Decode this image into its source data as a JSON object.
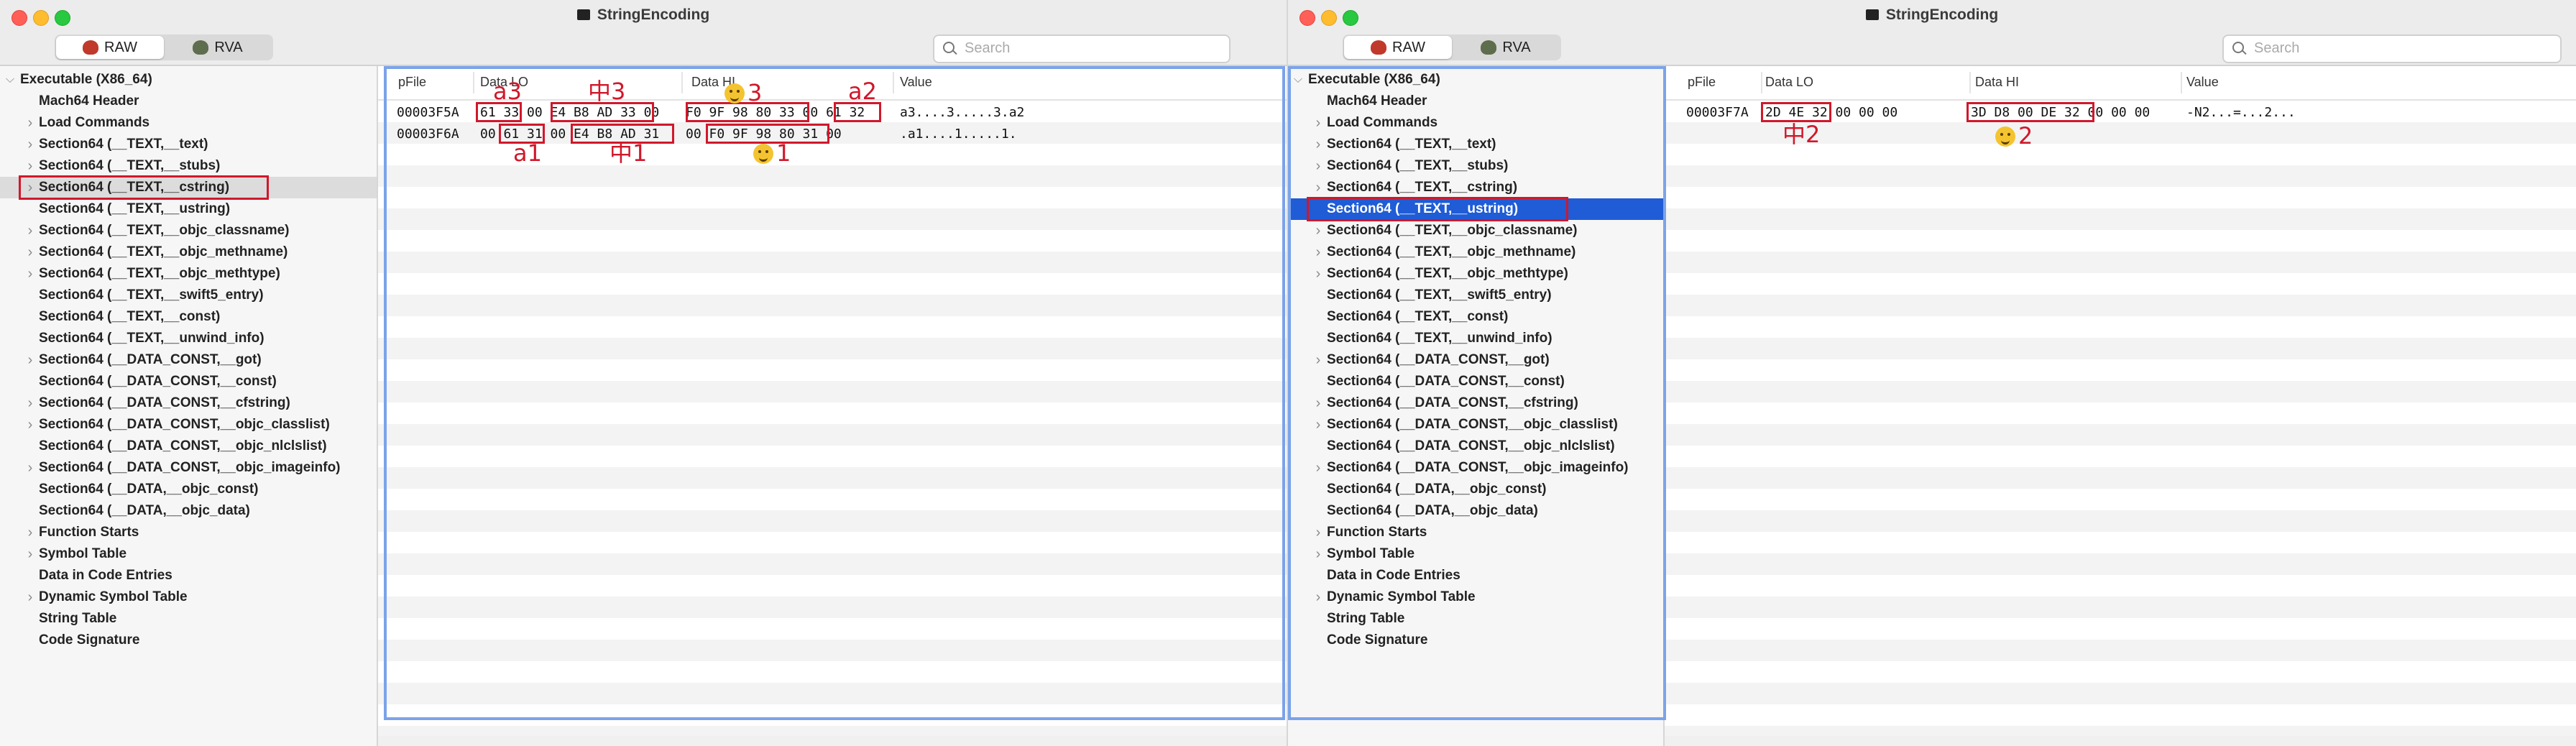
{
  "left": {
    "title": "StringEncoding",
    "segments": [
      {
        "label": "RAW",
        "icon": "raw-bug-icon"
      },
      {
        "label": "RVA",
        "icon": "rva-bug-icon"
      }
    ],
    "active_segment": 0,
    "search_placeholder": "Search",
    "tree": [
      {
        "label": "Executable  (X86_64)",
        "expander": "open"
      },
      {
        "label": "Mach64 Header",
        "expander": "none"
      },
      {
        "label": "Load Commands",
        "expander": "closed"
      },
      {
        "label": "Section64 (__TEXT,__text)",
        "expander": "closed"
      },
      {
        "label": "Section64 (__TEXT,__stubs)",
        "expander": "closed"
      },
      {
        "label": "Section64 (__TEXT,__cstring)",
        "expander": "closed",
        "selected": "gray",
        "boxed": true
      },
      {
        "label": "Section64 (__TEXT,__ustring)",
        "expander": "none"
      },
      {
        "label": "Section64 (__TEXT,__objc_classname)",
        "expander": "closed"
      },
      {
        "label": "Section64 (__TEXT,__objc_methname)",
        "expander": "closed"
      },
      {
        "label": "Section64 (__TEXT,__objc_methtype)",
        "expander": "closed"
      },
      {
        "label": "Section64 (__TEXT,__swift5_entry)",
        "expander": "none"
      },
      {
        "label": "Section64 (__TEXT,__const)",
        "expander": "none"
      },
      {
        "label": "Section64 (__TEXT,__unwind_info)",
        "expander": "none"
      },
      {
        "label": "Section64 (__DATA_CONST,__got)",
        "expander": "closed"
      },
      {
        "label": "Section64 (__DATA_CONST,__const)",
        "expander": "none"
      },
      {
        "label": "Section64 (__DATA_CONST,__cfstring)",
        "expander": "closed"
      },
      {
        "label": "Section64 (__DATA_CONST,__objc_classlist)",
        "expander": "closed"
      },
      {
        "label": "Section64 (__DATA_CONST,__objc_nlclslist)",
        "expander": "none"
      },
      {
        "label": "Section64 (__DATA_CONST,__objc_imageinfo)",
        "expander": "closed"
      },
      {
        "label": "Section64 (__DATA,__objc_const)",
        "expander": "none"
      },
      {
        "label": "Section64 (__DATA,__objc_data)",
        "expander": "none"
      },
      {
        "label": "Function Starts",
        "expander": "closed"
      },
      {
        "label": "Symbol Table",
        "expander": "closed"
      },
      {
        "label": "Data in Code Entries",
        "expander": "none"
      },
      {
        "label": "Dynamic Symbol Table",
        "expander": "closed"
      },
      {
        "label": "String Table",
        "expander": "none"
      },
      {
        "label": "Code Signature",
        "expander": "none"
      }
    ],
    "columns": [
      "pFile",
      "Data LO",
      "Data HI",
      "Value"
    ],
    "rows": [
      {
        "pfile": "00003F5A",
        "lo": "61 33 00 E4 B8 AD 33 00",
        "hi": "F0 9F 98 80 33 00 61 32",
        "value": "a3....3.....3.a2"
      },
      {
        "pfile": "00003F6A",
        "lo": "00 61 31 00 E4 B8 AD 31",
        "hi": "00 F0 9F 98 80 31 00",
        "value": ".a1....1.....1."
      }
    ],
    "annotations": [
      {
        "text": "a3",
        "emoji": false
      },
      {
        "text": "中3",
        "emoji": false
      },
      {
        "text": "3",
        "emoji": true
      },
      {
        "text": "a2",
        "emoji": false
      },
      {
        "text": "a1",
        "emoji": false
      },
      {
        "text": "中1",
        "emoji": false
      },
      {
        "text": "1",
        "emoji": true
      }
    ]
  },
  "right": {
    "title": "StringEncoding",
    "segments": [
      {
        "label": "RAW",
        "icon": "raw-bug-icon"
      },
      {
        "label": "RVA",
        "icon": "rva-bug-icon"
      }
    ],
    "active_segment": 0,
    "search_placeholder": "Search",
    "tree": [
      {
        "label": "Executable  (X86_64)",
        "expander": "open"
      },
      {
        "label": "Mach64 Header",
        "expander": "none"
      },
      {
        "label": "Load Commands",
        "expander": "closed"
      },
      {
        "label": "Section64 (__TEXT,__text)",
        "expander": "closed"
      },
      {
        "label": "Section64 (__TEXT,__stubs)",
        "expander": "closed"
      },
      {
        "label": "Section64 (__TEXT,__cstring)",
        "expander": "closed"
      },
      {
        "label": "Section64 (__TEXT,__ustring)",
        "expander": "none",
        "selected": "blue",
        "boxed": true
      },
      {
        "label": "Section64 (__TEXT,__objc_classname)",
        "expander": "closed"
      },
      {
        "label": "Section64 (__TEXT,__objc_methname)",
        "expander": "closed"
      },
      {
        "label": "Section64 (__TEXT,__objc_methtype)",
        "expander": "closed"
      },
      {
        "label": "Section64 (__TEXT,__swift5_entry)",
        "expander": "none"
      },
      {
        "label": "Section64 (__TEXT,__const)",
        "expander": "none"
      },
      {
        "label": "Section64 (__TEXT,__unwind_info)",
        "expander": "none"
      },
      {
        "label": "Section64 (__DATA_CONST,__got)",
        "expander": "closed"
      },
      {
        "label": "Section64 (__DATA_CONST,__const)",
        "expander": "none"
      },
      {
        "label": "Section64 (__DATA_CONST,__cfstring)",
        "expander": "closed"
      },
      {
        "label": "Section64 (__DATA_CONST,__objc_classlist)",
        "expander": "closed"
      },
      {
        "label": "Section64 (__DATA_CONST,__objc_nlclslist)",
        "expander": "none"
      },
      {
        "label": "Section64 (__DATA_CONST,__objc_imageinfo)",
        "expander": "closed"
      },
      {
        "label": "Section64 (__DATA,__objc_const)",
        "expander": "none"
      },
      {
        "label": "Section64 (__DATA,__objc_data)",
        "expander": "none"
      },
      {
        "label": "Function Starts",
        "expander": "closed"
      },
      {
        "label": "Symbol Table",
        "expander": "closed"
      },
      {
        "label": "Data in Code Entries",
        "expander": "none"
      },
      {
        "label": "Dynamic Symbol Table",
        "expander": "closed"
      },
      {
        "label": "String Table",
        "expander": "none"
      },
      {
        "label": "Code Signature",
        "expander": "none"
      }
    ],
    "columns": [
      "pFile",
      "Data LO",
      "Data HI",
      "Value"
    ],
    "rows": [
      {
        "pfile": "00003F7A",
        "lo": "2D 4E 32 00 00 00",
        "hi": "3D D8 00 DE 32 00 00 00",
        "value": "-N2...=...2..."
      }
    ],
    "annotations": [
      {
        "text": "中2",
        "emoji": false
      },
      {
        "text": "2",
        "emoji": true
      }
    ]
  }
}
